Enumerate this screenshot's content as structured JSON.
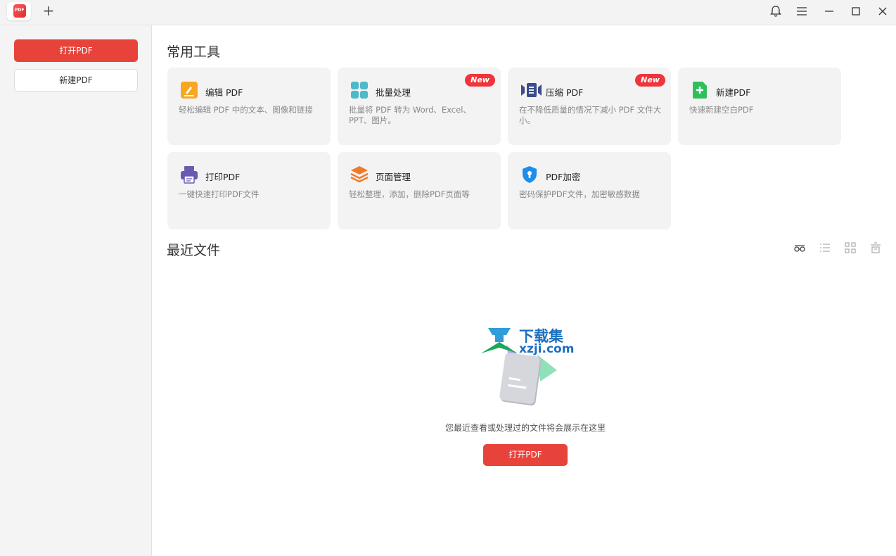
{
  "titlebar": {
    "logo_text": "PDF",
    "add_tab": "+"
  },
  "sidebar": {
    "open_pdf": "打开PDF",
    "new_pdf": "新建PDF"
  },
  "tools_section": {
    "title": "常用工具",
    "cards": [
      {
        "title": "编辑 PDF",
        "desc": "轻松编辑 PDF 中的文本、图像和链接",
        "icon": "edit-icon",
        "color": "#f7a722"
      },
      {
        "title": "批量处理",
        "desc": "批量将 PDF 转为 Word、Excel、PPT、图片。",
        "icon": "batch-icon",
        "color": "#4fb8c9",
        "badge": "New"
      },
      {
        "title": "压缩 PDF",
        "desc": "在不降低质量的情况下减小 PDF 文件大小。",
        "icon": "compress-icon",
        "color": "#3b4d8c",
        "badge": "New"
      },
      {
        "title": "新建PDF",
        "desc": "快速新建空白PDF",
        "icon": "new-pdf-icon",
        "color": "#2fbf5a"
      },
      {
        "title": "打印PDF",
        "desc": "一键快速打印PDF文件",
        "icon": "print-icon",
        "color": "#6a5bb0"
      },
      {
        "title": "页面管理",
        "desc": "轻松整理，添加，删除PDF页面等",
        "icon": "pages-icon",
        "color": "#f07a2a"
      },
      {
        "title": "PDF加密",
        "desc": "密码保护PDF文件，加密敏感数据",
        "icon": "shield-icon",
        "color": "#1e8ee8"
      }
    ]
  },
  "recent_section": {
    "title": "最近文件",
    "empty_text": "您最近查看或处理过的文件将会展示在这里",
    "open_pdf": "打开PDF",
    "watermark_cn": "下载集",
    "watermark_en": "xzji.com"
  }
}
